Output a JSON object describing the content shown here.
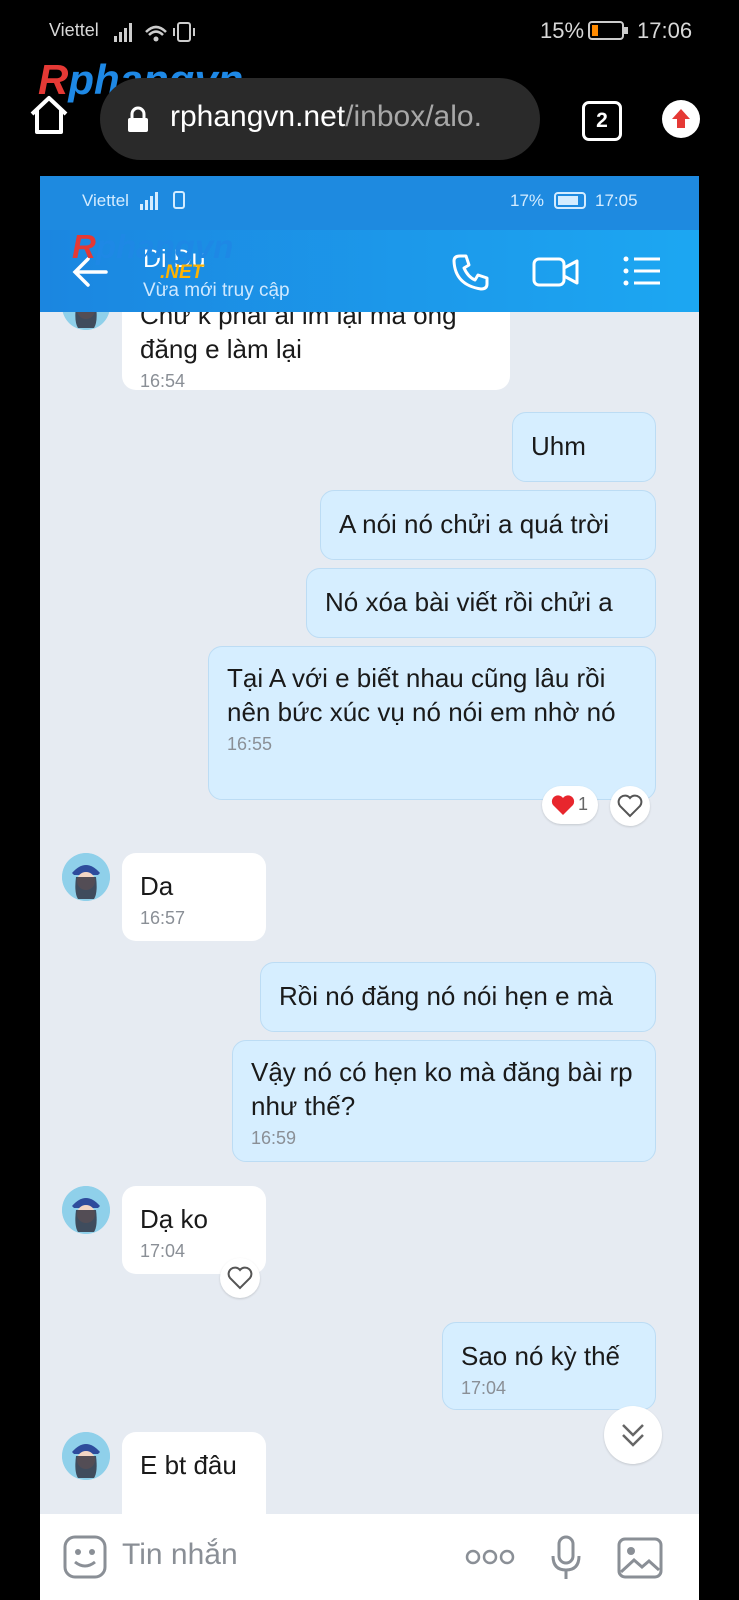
{
  "outer_status": {
    "carrier": "Viettel",
    "battery_pct": "15%",
    "time": "17:06"
  },
  "browser": {
    "url_main": "rphangvn.net",
    "url_path": "/inbox/alo.",
    "tab_count": "2"
  },
  "watermark": {
    "r": "R",
    "phang": "phangvn",
    "net": ".NET"
  },
  "inner_status": {
    "carrier": "Viettel",
    "battery_pct": "17%",
    "time": "17:05"
  },
  "chat_header": {
    "name": "Di Du",
    "status": "Vừa mới truy cập"
  },
  "messages": [
    {
      "side": "in",
      "text": "Chứ k phải ai im lại mà ông\nđăng e làm lại",
      "time": "16:54"
    },
    {
      "side": "out",
      "text": "Uhm"
    },
    {
      "side": "out",
      "text": "A nói nó chửi a quá trời"
    },
    {
      "side": "out",
      "text": "Nó xóa bài viết rồi chửi a"
    },
    {
      "side": "out",
      "text": "Tại A với e biết nhau cũng lâu rồi nên bức xúc vụ nó nói em nhờ nó",
      "time": "16:55",
      "reaction_count": "1"
    },
    {
      "side": "in",
      "text": "Da",
      "time": "16:57"
    },
    {
      "side": "out",
      "text": "Rồi nó đăng nó nói hẹn e mà"
    },
    {
      "side": "out",
      "text": "Vậy nó có hẹn ko mà đăng bài rp như thế?",
      "time": "16:59"
    },
    {
      "side": "in",
      "text": "Dạ ko",
      "time": "17:04"
    },
    {
      "side": "out",
      "text": "Sao nó kỳ thế",
      "time": "17:04"
    },
    {
      "side": "in",
      "text": "E bt đâu"
    }
  ],
  "composer": {
    "placeholder": "Tin nhắn"
  },
  "colors": {
    "header": "#1b86e0",
    "bubble_out": "#d6eeff",
    "bubble_in": "#ffffff",
    "bg": "#e6ebf2"
  }
}
